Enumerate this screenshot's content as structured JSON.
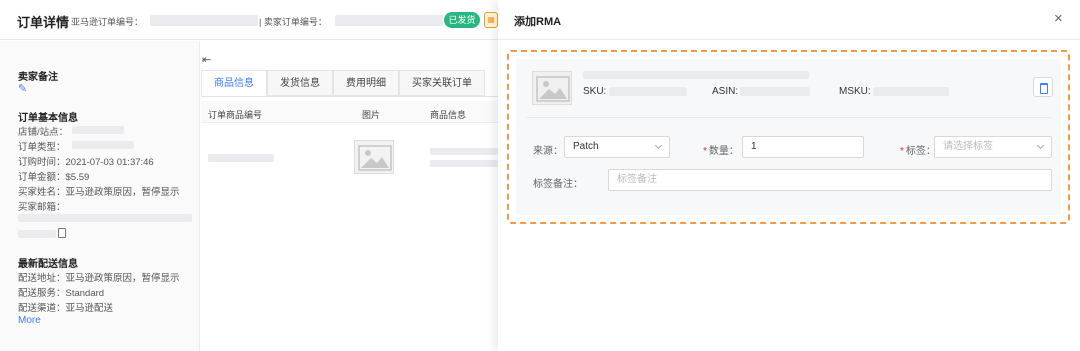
{
  "order_page": {
    "title": "订单详情",
    "amazon_order_label": "亚马逊订单编号：",
    "seller_order_label": "| 卖家订单编号：",
    "status_badge": "已发货",
    "badge_icon_text": "▦",
    "seller_note_title": "卖家备注",
    "basic_info_title": "订单基本信息",
    "basic_info": {
      "shop_label": "店铺/站点：",
      "order_type_label": "订单类型：",
      "order_time": "订购时间：2021-07-03 01:37:46",
      "order_amount": "订单金额：$5.59",
      "buyer_name": "买家姓名：亚马逊政策原因，暂停显示",
      "buyer_email_label": "买家邮箱："
    },
    "shipping_title": "最新配送信息",
    "shipping": {
      "address": "配送地址：亚马逊政策原因，暂停显示",
      "service": "配送服务：Standard",
      "channel": "配送渠道：亚马逊配送"
    },
    "more_link": "More",
    "collapse_icon_glyph": "⇤",
    "tabs": [
      "商品信息",
      "发货信息",
      "费用明细",
      "买家关联订单"
    ],
    "table_headers": [
      "订单商品编号",
      "图片",
      "商品信息"
    ]
  },
  "drawer": {
    "title": "添加RMA",
    "close_glyph": "×",
    "product": {
      "sku_label": "SKU:",
      "asin_label": "ASIN:",
      "msku_label": "MSKU:"
    },
    "form": {
      "source_label": "来源：",
      "source_value": "Patch",
      "quantity_label": "数量：",
      "quantity_value": "1",
      "tag_label": "标签：",
      "tag_placeholder": "请选择标签",
      "tag_note_label": "标签备注：",
      "tag_note_placeholder": "标签备注"
    }
  }
}
